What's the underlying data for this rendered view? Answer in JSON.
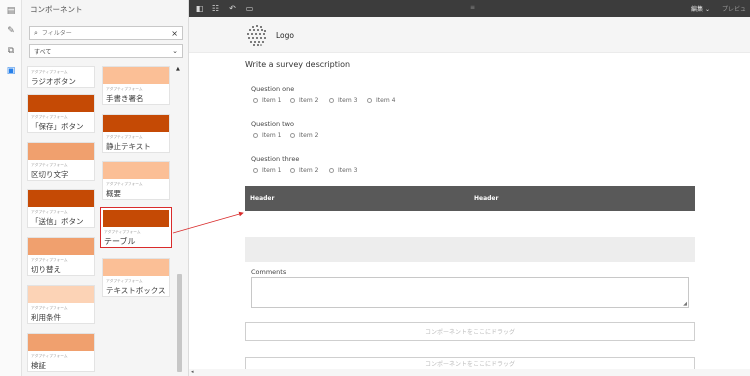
{
  "panel": {
    "title": "コンポーネント",
    "search_placeholder": "フィルター",
    "filter_selected": "すべて"
  },
  "components": [
    {
      "category": "アダプティブフォーム",
      "name": "ラジオボタン",
      "color": "#f0a06e"
    },
    {
      "category": "アダプティブフォーム",
      "name": "「保存」ボタン",
      "color": "#c54a05"
    },
    {
      "category": "アダプティブフォーム",
      "name": "区切り文字",
      "color": "#f0a06e"
    },
    {
      "category": "アダプティブフォーム",
      "name": "「送信」ボタン",
      "color": "#c54a05"
    },
    {
      "category": "アダプティブフォーム",
      "name": "切り替え",
      "color": "#f0a06e"
    },
    {
      "category": "アダプティブフォーム",
      "name": "利用条件",
      "color": "#fcd3b6"
    },
    {
      "category": "アダプティブフォーム",
      "name": "検証",
      "color": "#f0a06e"
    },
    {
      "category": "アダプティブフォーム",
      "name": "手書き署名",
      "color": "#fbbf96"
    },
    {
      "category": "アダプティブフォーム",
      "name": "静止テキスト",
      "color": "#c54a05"
    },
    {
      "category": "アダプティブフォーム",
      "name": "概要",
      "color": "#fbbf96"
    },
    {
      "category": "アダプティブフォーム",
      "name": "テーブル",
      "color": "#c54a05"
    },
    {
      "category": "アダプティブフォーム",
      "name": "テキストボックス",
      "color": "#fbbf96"
    }
  ],
  "toolbar": {
    "center_text": "≡",
    "mode": "編集",
    "preview": "プレビュー"
  },
  "form": {
    "logo_text": "Logo",
    "description": "Write a survey description",
    "q1": {
      "label": "Question one",
      "items": [
        "Item 1",
        "Item 2",
        "Item 3",
        "Item 4"
      ]
    },
    "q2": {
      "label": "Question two",
      "items": [
        "Item 1",
        "Item 2"
      ]
    },
    "q3": {
      "label": "Question three",
      "items": [
        "Item 1",
        "Item 2",
        "Item 3"
      ]
    },
    "table_headers": [
      "Header",
      "Header"
    ],
    "comments_label": "Comments",
    "drop_zone_text": "コンポーネントをここにドラッグ"
  },
  "colors": {
    "accent": "#c54a05",
    "highlight": "#d92b2b",
    "toolbar": "#3c3c3c",
    "table_header": "#595959"
  }
}
